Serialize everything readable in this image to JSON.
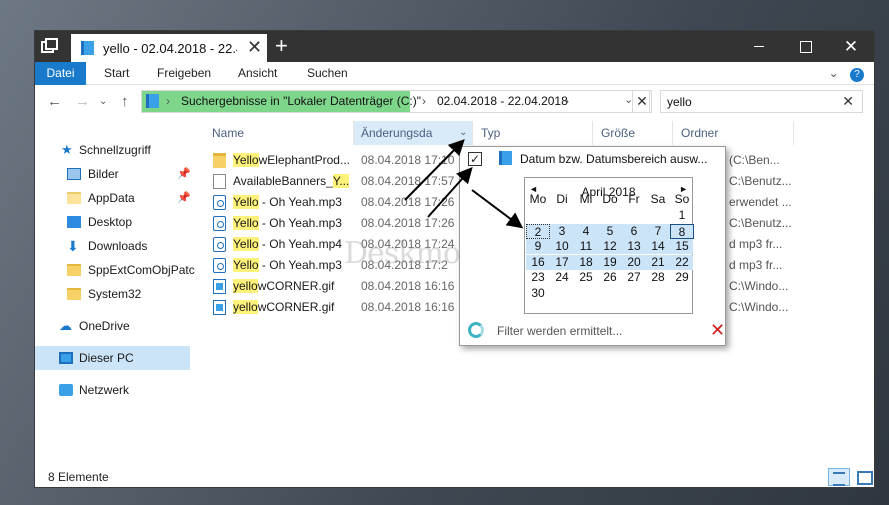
{
  "window": {
    "tab_title": "yello - 02.04.2018 - 22.4",
    "tab_close": "✕",
    "tab_add": "+",
    "min": "",
    "max": "",
    "close": "✕"
  },
  "ribbon": {
    "tabs": [
      "Datei",
      "Start",
      "Freigeben",
      "Ansicht",
      "Suchen"
    ],
    "expand_icon": "⌄",
    "help": "?"
  },
  "nav": {
    "back": "←",
    "forward": "→",
    "recent": "⌄",
    "up": "↑",
    "address_segments": [
      "Suchergebnisse in \"Lokaler Datenträger (C:)\"",
      "02.04.2018 - 22.04.2018"
    ],
    "address_sep": "›",
    "address_dropdown": "⌄",
    "address_clear": "✕",
    "search_value": "yello",
    "search_clear": "✕"
  },
  "sidebar": {
    "items": [
      {
        "label": "Schnellzugriff",
        "icon": "star-icon"
      },
      {
        "label": "Bilder",
        "icon": "pictures-icon",
        "pinned": true
      },
      {
        "label": "AppData",
        "icon": "folder-icon",
        "pinned": true
      },
      {
        "label": "Desktop",
        "icon": "desktop-icon"
      },
      {
        "label": "Downloads",
        "icon": "download-icon"
      },
      {
        "label": "SppExtComObjPatc",
        "icon": "folder-icon"
      },
      {
        "label": "System32",
        "icon": "folder-icon"
      },
      {
        "label": "OneDrive",
        "icon": "cloud-icon"
      },
      {
        "label": "Dieser PC",
        "icon": "pc-icon",
        "selected": true
      },
      {
        "label": "Netzwerk",
        "icon": "network-icon"
      }
    ],
    "pin_glyph": "📌"
  },
  "columns": {
    "name": "Name",
    "date": "Änderungsda",
    "sort_glyph": "⌄",
    "type": "Typ",
    "size": "Größe",
    "folder": "Ordner"
  },
  "files": [
    {
      "highlight": "Yello",
      "rest": "wElephantProd...",
      "date": "08.04.2018 17:10",
      "tail": "(C:\\Ben...",
      "icon": "folder"
    },
    {
      "highlight": "",
      "rest": "AvailableBanners_",
      "highlight_after": "Y...",
      "date": "08.04.2018 17:57",
      "tail": "C:\\Benutz...",
      "icon": "doc"
    },
    {
      "highlight": "Yello",
      "rest": " - Oh Yeah.mp3",
      "date": "08.04.2018 17:26",
      "tail": "erwendet ...",
      "icon": "mp3"
    },
    {
      "highlight": "Yello",
      "rest": " - Oh Yeah.mp3",
      "date": "08.04.2018 17:26",
      "tail": "C:\\Benutz...",
      "icon": "mp3"
    },
    {
      "highlight": "Yello",
      "rest": " - Oh Yeah.mp4",
      "date": "08.04.2018 17:24",
      "tail": "d mp3 fr...",
      "icon": "mp3"
    },
    {
      "highlight": "Yello",
      "rest": " - Oh Yeah.mp3",
      "date": "08.04.2018 17:2",
      "tail": "d mp3 fr...",
      "icon": "mp3"
    },
    {
      "highlight": "yello",
      "rest": "wCORNER.gif",
      "date": "08.04.2018 16:16",
      "tail": "C:\\Windo...",
      "icon": "gif"
    },
    {
      "highlight": "yello",
      "rest": "wCORNER.gif",
      "date": "08.04.2018 16:16",
      "tail": "C:\\Windo...",
      "icon": "gif"
    }
  ],
  "status": {
    "count": "8 Elemente"
  },
  "popup": {
    "checkbox": "✓",
    "title": "Datum bzw. Datumsbereich ausw...",
    "calendar": {
      "prev": "◄",
      "next": "►",
      "month": "April 2018",
      "weekdays": [
        "Mo",
        "Di",
        "Mi",
        "Do",
        "Fr",
        "Sa",
        "So"
      ],
      "weeks": [
        [
          "",
          "",
          "",
          "",
          "",
          "",
          "1"
        ],
        [
          "2",
          "3",
          "4",
          "5",
          "6",
          "7",
          "8"
        ],
        [
          "9",
          "10",
          "11",
          "12",
          "13",
          "14",
          "15"
        ],
        [
          "16",
          "17",
          "18",
          "19",
          "20",
          "21",
          "22"
        ],
        [
          "23",
          "24",
          "25",
          "26",
          "27",
          "28",
          "29"
        ],
        [
          "30",
          "",
          "",
          "",
          "",
          "",
          ""
        ]
      ],
      "range_start": "2",
      "range_end": "22",
      "today": "8"
    },
    "status_text": "Filter werden ermittelt...",
    "cancel": "✕"
  },
  "watermark": "Deskmodder.de",
  "colors": {
    "accent": "#1979ca",
    "address_highlight": "#7ed68b",
    "search_hit": "#fff27a",
    "selection": "#cce4f7",
    "cancel": "#d21f1f"
  }
}
